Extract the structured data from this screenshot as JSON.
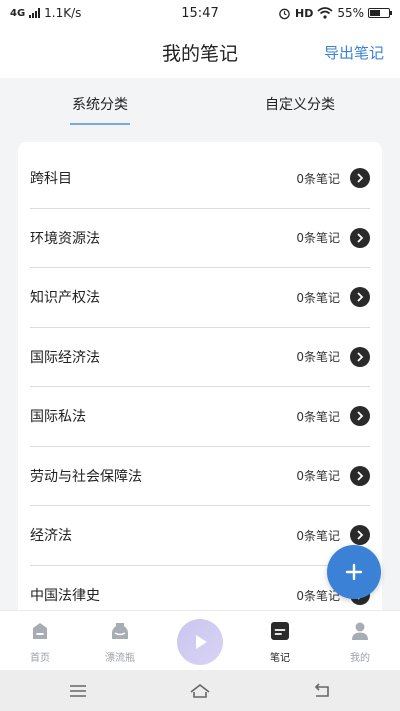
{
  "status_bar": {
    "network": "4G",
    "speed": "1.1K/s",
    "time": "15:47",
    "hd": "HD",
    "battery": "55%",
    "battery_level": 0.55
  },
  "header": {
    "title": "我的笔记",
    "export_label": "导出笔记"
  },
  "tabs": [
    {
      "label": "系统分类",
      "active": true
    },
    {
      "label": "自定义分类",
      "active": false
    }
  ],
  "categories": [
    {
      "label": "跨科目",
      "count": "0条笔记"
    },
    {
      "label": "环境资源法",
      "count": "0条笔记"
    },
    {
      "label": "知识产权法",
      "count": "0条笔记"
    },
    {
      "label": "国际经济法",
      "count": "0条笔记"
    },
    {
      "label": "国际私法",
      "count": "0条笔记"
    },
    {
      "label": "劳动与社会保障法",
      "count": "0条笔记"
    },
    {
      "label": "经济法",
      "count": "0条笔记"
    },
    {
      "label": "中国法律史",
      "count": "0条笔记"
    }
  ],
  "fab": {
    "icon": "plus-icon"
  },
  "bottom_nav": [
    {
      "label": "首页",
      "icon": "home-icon",
      "active": false
    },
    {
      "label": "漂流瓶",
      "icon": "bottle-icon",
      "active": false
    },
    {
      "label": "",
      "icon": "play-icon",
      "active": false
    },
    {
      "label": "笔记",
      "icon": "note-icon",
      "active": true
    },
    {
      "label": "我的",
      "icon": "profile-icon",
      "active": false
    }
  ],
  "colors": {
    "accent": "#3b82d6",
    "tab_underline": "#7aa9e0",
    "background": "#f3f4f6"
  }
}
